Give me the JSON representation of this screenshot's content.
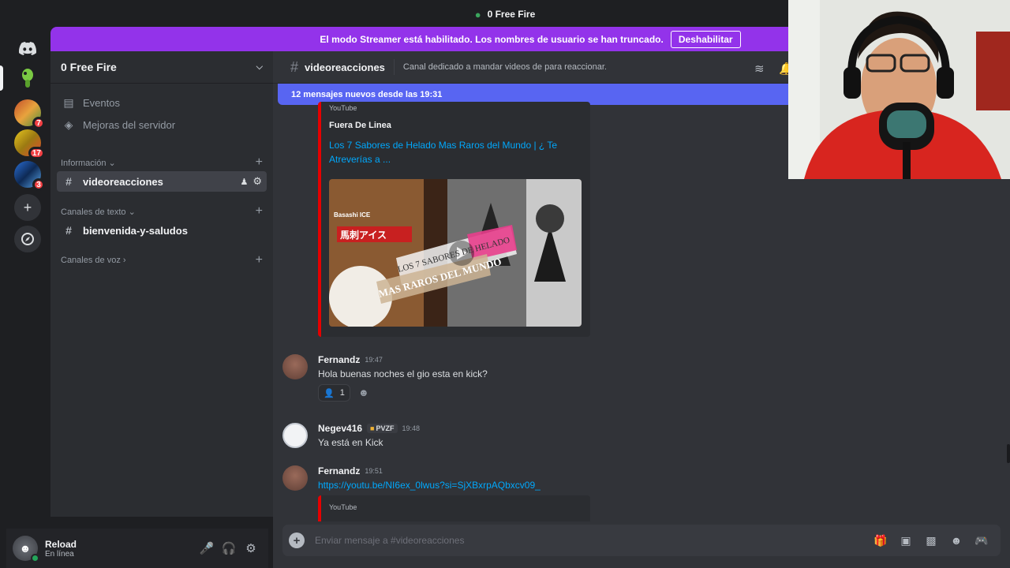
{
  "window": {
    "title": "0 Free Fire"
  },
  "servers": [
    {
      "name": "discord-home",
      "badge": ""
    },
    {
      "name": "free-fire",
      "badge": ""
    },
    {
      "name": "server-2",
      "badge": "7"
    },
    {
      "name": "server-3",
      "badge": "17"
    },
    {
      "name": "server-4",
      "badge": "3"
    }
  ],
  "banner": {
    "text": "El modo Streamer está habilitado. Los nombres de usuario se han truncado.",
    "button": "Deshabilitar"
  },
  "sidebar": {
    "guild_name": "0 Free Fire",
    "items": [
      {
        "label": "Eventos"
      },
      {
        "label": "Mejoras del servidor"
      }
    ],
    "categories": [
      {
        "label": "Información",
        "channels": [
          "videoreacciones"
        ]
      },
      {
        "label": "Canales de texto",
        "channels": [
          "bienvenida-y-saludos"
        ]
      },
      {
        "label": "Canales de voz",
        "channels": []
      }
    ]
  },
  "user": {
    "name": "Reload",
    "status": "En línea"
  },
  "channel": {
    "name": "videoreacciones",
    "topic": "Canal dedicado a mandar videos de para reaccionar.",
    "new_messages": "12 mensajes nuevos desde las 19:31"
  },
  "embed1": {
    "provider": "YouTube",
    "author": "Fuera De Linea",
    "title": "Los 7 Sabores de Helado Mas Raros del Mundo | ¿ Te Atreverías a ...",
    "thumb_texts": [
      "Basashi ICE",
      "馬刺アイス",
      "LOS 7 SABORES DE HELADO",
      "MAS RAROS DEL MUNDO"
    ]
  },
  "messages": [
    {
      "author": "Fernandz",
      "time": "19:47",
      "text": "Hola buenas noches el gio esta en kick?",
      "reaction_count": "1"
    },
    {
      "author": "Negev416",
      "tag": "PVZF",
      "time": "19:48",
      "text": "Ya está en Kick"
    },
    {
      "author": "Fernandz",
      "time": "19:51",
      "link": "https://youtu.be/NI6ex_0lwus?si=SjXBxrpAQbxcv09_",
      "embed_provider": "YouTube"
    }
  ],
  "composer": {
    "placeholder": "Enviar mensaje a #videoreacciones"
  },
  "colors": {
    "accent": "#5865f2",
    "banner": "#9333ea",
    "link": "#00a8fc",
    "embed_bar": "#e60000",
    "online": "#23a55a"
  }
}
